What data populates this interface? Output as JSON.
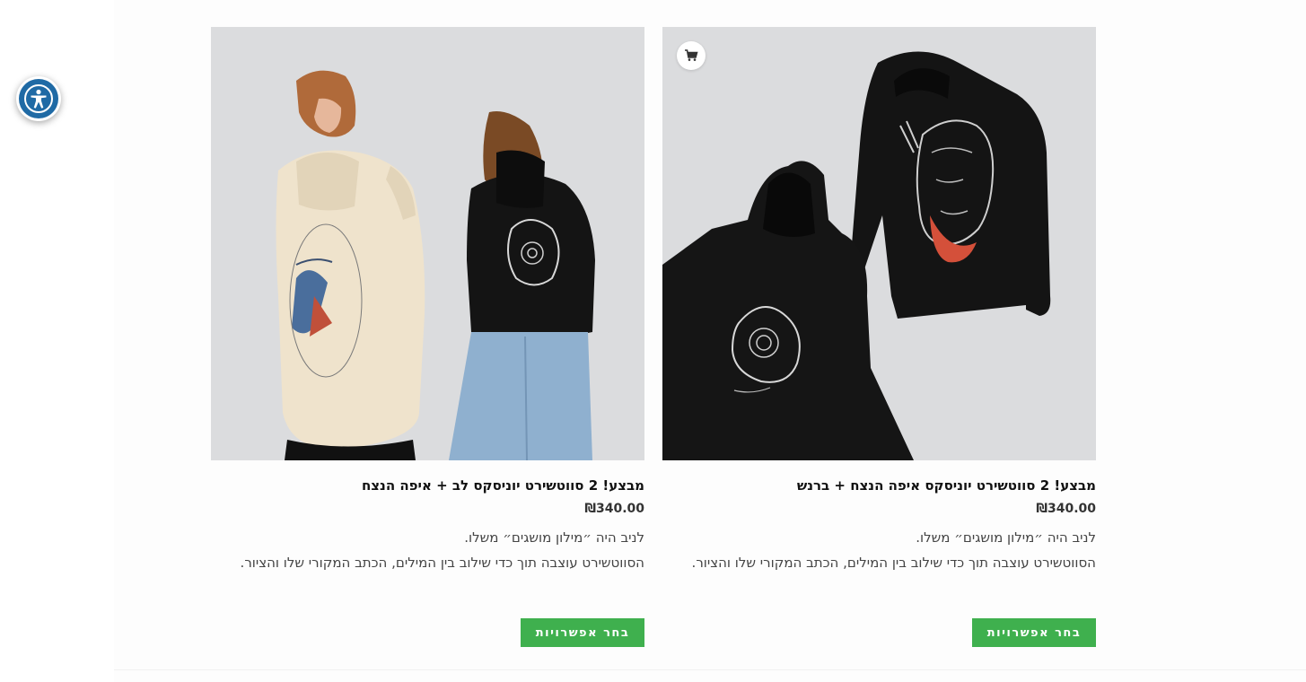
{
  "accessibility": {
    "icon": "accessibility-icon",
    "color": "#1f6aa5"
  },
  "products": [
    {
      "title": "מבצע! 2 סווטשירט יוניסקס איפה הנצח + ברנש",
      "price": "₪340.00",
      "description_line1": "לניב היה ״מילון מושגים״ משלו.",
      "description_line2": "הסווטשירט עוצבה תוך כדי שילוב בין המילים, הכתב המקורי שלו והציור.",
      "button_label": "בחר אפשרויות",
      "badge_icon": "cart-icon"
    },
    {
      "title": "מבצע! 2 סווטשירט יוניסקס לב + איפה הנצח",
      "price": "₪340.00",
      "description_line1": "לניב היה ״מילון מושגים״ משלו.",
      "description_line2": "הסווטשירט עוצבה תוך כדי שילוב בין המילים, הכתב המקורי שלו והציור.",
      "button_label": "בחר אפשרויות"
    }
  ],
  "colors": {
    "button": "#3fb04e",
    "image_bg": "#dbdcde",
    "hoodie_black": "#141414",
    "hoodie_cream": "#efe3cc",
    "accent_red": "#d4503a"
  }
}
